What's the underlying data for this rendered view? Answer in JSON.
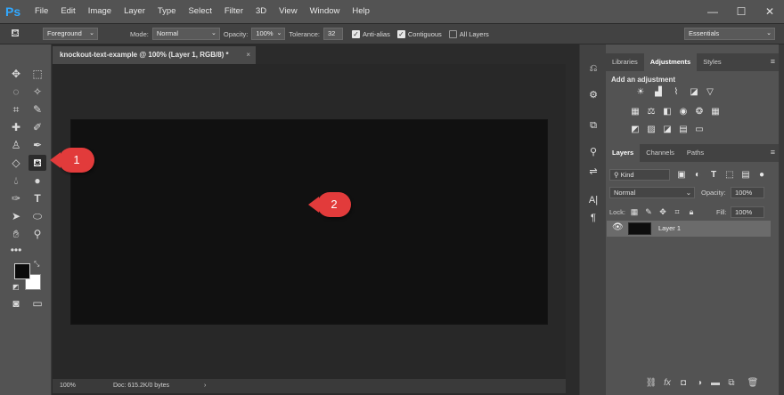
{
  "app": {
    "logo": "Ps"
  },
  "menu": [
    "File",
    "Edit",
    "Image",
    "Layer",
    "Type",
    "Select",
    "Filter",
    "3D",
    "View",
    "Window",
    "Help"
  ],
  "window_controls": {
    "minimize": "—",
    "maximize": "☐",
    "close": "✕"
  },
  "options_bar": {
    "fill_source": "Foreground",
    "mode_label": "Mode:",
    "mode_value": "Normal",
    "opacity_label": "Opacity:",
    "opacity_value": "100%",
    "tolerance_label": "Tolerance:",
    "tolerance_value": "32",
    "anti_alias": {
      "label": "Anti-alias",
      "checked": true
    },
    "contiguous": {
      "label": "Contiguous",
      "checked": true
    },
    "all_layers": {
      "label": "All Layers",
      "checked": false
    },
    "workspace": "Essentials"
  },
  "document": {
    "tab_title": "knockout-text-example @ 100% (Layer 1, RGB/8) *",
    "close": "×",
    "zoom": "100%",
    "doc_info": "Doc: 615.2K/0 bytes",
    "status_arrow": "›"
  },
  "callouts": [
    "1",
    "2"
  ],
  "adjustments_panel": {
    "tabs": [
      "Libraries",
      "Adjustments",
      "Styles"
    ],
    "active_tab": "Adjustments",
    "heading": "Add an adjustment"
  },
  "layers_panel": {
    "tabs": [
      "Layers",
      "Channels",
      "Paths"
    ],
    "active_tab": "Layers",
    "filter_kind": "Kind",
    "blend_mode": "Normal",
    "opacity_label": "Opacity:",
    "opacity_value": "100%",
    "lock_label": "Lock:",
    "fill_label": "Fill:",
    "fill_value": "100%",
    "layers": [
      {
        "name": "Layer 1",
        "visible": true
      }
    ]
  },
  "colors": {
    "accent": "#31a8ff",
    "callout": "#e23b3b",
    "canvas": "#111111",
    "ui_bg": "#535353"
  }
}
